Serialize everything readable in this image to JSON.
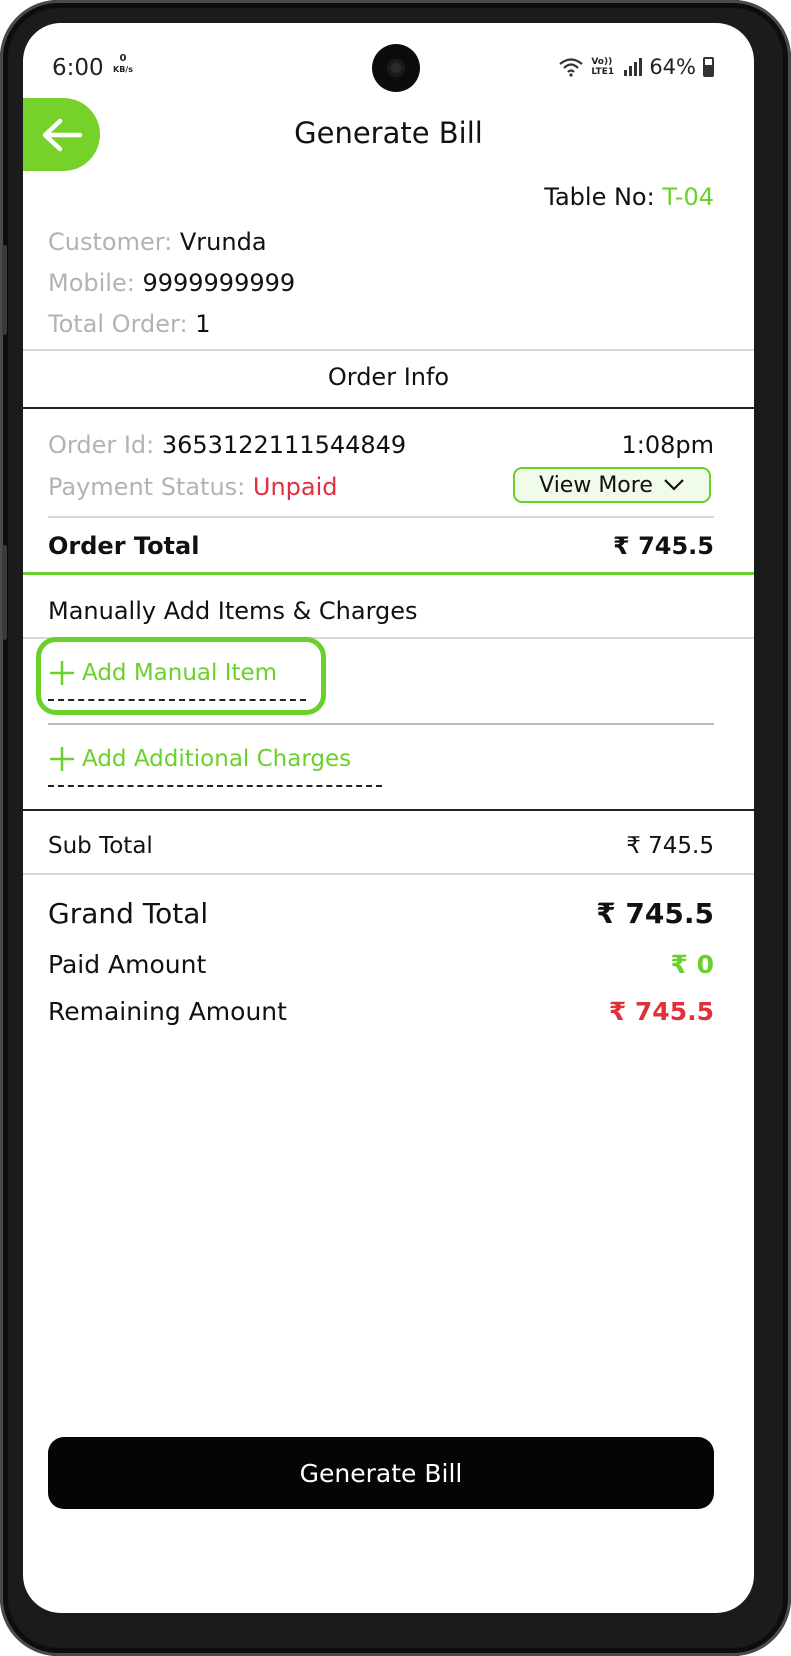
{
  "status_bar": {
    "time": "6:00",
    "kbs_value": "0",
    "kbs_unit": "KB/s",
    "volte": "Vo)) LTE1",
    "battery": "64%"
  },
  "header": {
    "title": "Generate Bill",
    "back_icon": "arrow-left-icon"
  },
  "table": {
    "label": "Table No:",
    "value": "T-04"
  },
  "customer": {
    "name_label": "Customer:",
    "name": "Vrunda",
    "mobile_label": "Mobile:",
    "mobile": "9999999999",
    "total_order_label": "Total Order:",
    "total_order": "1"
  },
  "order_info": {
    "title": "Order Info",
    "order_id_label": "Order Id:",
    "order_id": "3653122111544849",
    "time": "1:08pm",
    "payment_status_label": "Payment Status:",
    "payment_status": "Unpaid",
    "view_more_label": "View More",
    "order_total_label": "Order Total",
    "order_total": "₹ 745.5"
  },
  "manual": {
    "title": "Manually Add Items & Charges",
    "add_item_label": "Add Manual Item",
    "add_charges_label": "Add Additional Charges"
  },
  "summary": {
    "sub_total_label": "Sub Total",
    "sub_total": "₹ 745.5",
    "grand_total_label": "Grand Total",
    "grand_total": "₹ 745.5",
    "paid_label": "Paid Amount",
    "paid": "₹ 0",
    "remaining_label": "Remaining Amount",
    "remaining": "₹ 745.5"
  },
  "footer": {
    "generate_label": "Generate Bill"
  },
  "colors": {
    "accent": "#6ad02a",
    "danger": "#e0303c",
    "button": "#050505"
  }
}
